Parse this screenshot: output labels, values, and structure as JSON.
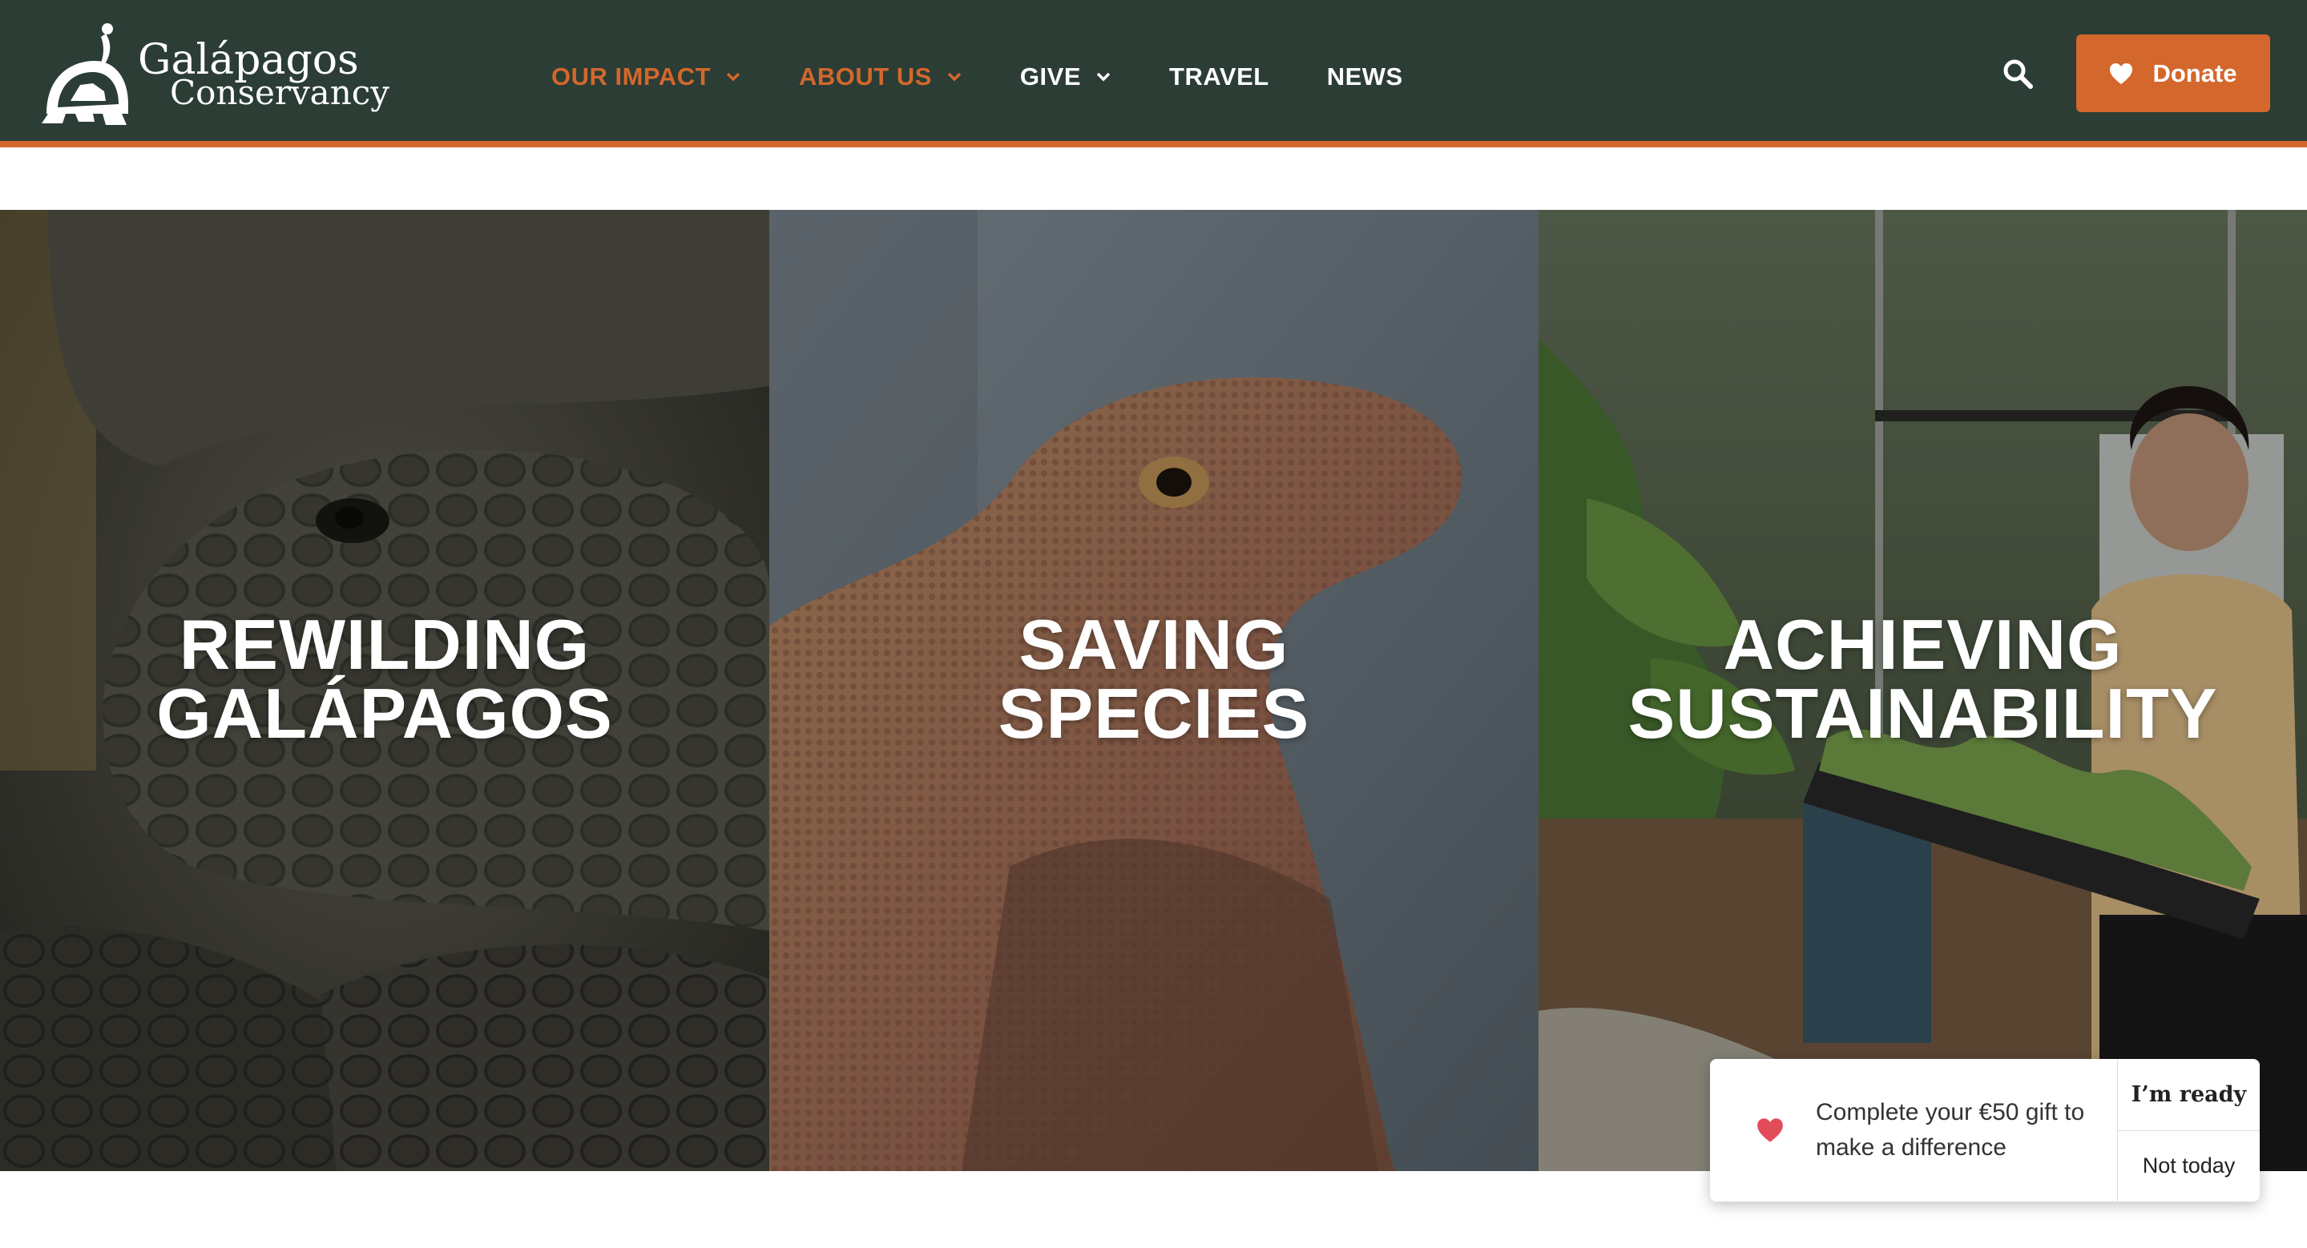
{
  "brand": {
    "name_line1": "Galápagos",
    "name_line2": "Conservancy",
    "accent_color": "#d4672c",
    "header_color": "#2b3d34"
  },
  "nav": {
    "items": [
      {
        "label": "OUR IMPACT",
        "has_dropdown": true,
        "active": true
      },
      {
        "label": "ABOUT US",
        "has_dropdown": true,
        "active": true
      },
      {
        "label": "GIVE",
        "has_dropdown": true,
        "active": false
      },
      {
        "label": "TRAVEL",
        "has_dropdown": false,
        "active": false
      },
      {
        "label": "NEWS",
        "has_dropdown": false,
        "active": false
      }
    ],
    "search_icon": "search-icon",
    "donate_label": "Donate",
    "donate_icon": "heart-icon"
  },
  "panels": [
    {
      "line1": "REWILDING",
      "line2": "GALÁPAGOS",
      "image": "giant-tortoise-photo"
    },
    {
      "line1": "SAVING",
      "line2": "SPECIES",
      "image": "land-iguana-photo"
    },
    {
      "line1": "ACHIEVING",
      "line2": "SUSTAINABILITY",
      "image": "woman-holding-seedlings-photo"
    }
  ],
  "popup": {
    "message": "Complete your €50 gift to make a difference",
    "icon": "heart-icon",
    "primary_label": "I’m ready",
    "secondary_label": "Not today"
  }
}
